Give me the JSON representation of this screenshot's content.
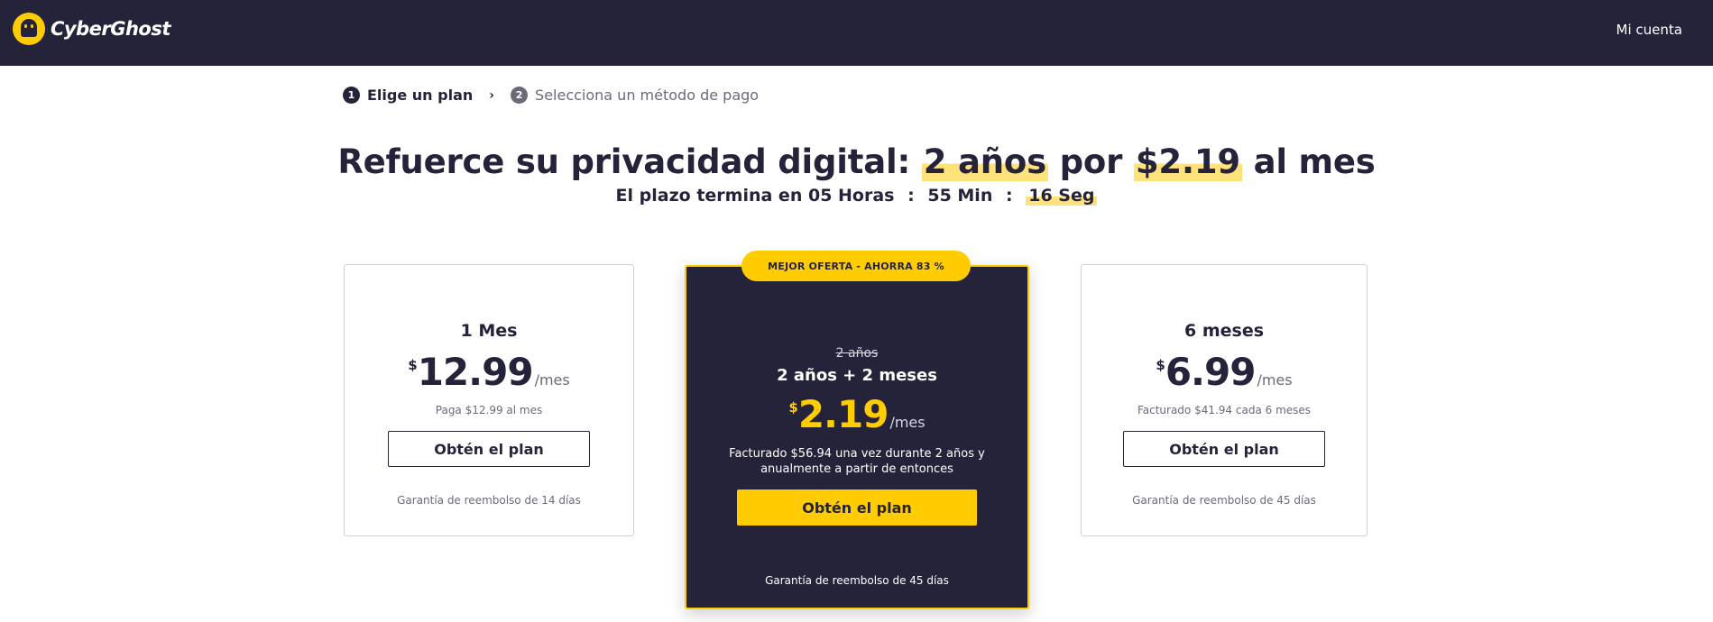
{
  "header": {
    "brand": "CyberGhost",
    "account_link": "Mi cuenta"
  },
  "steps": [
    {
      "number": "1",
      "label": "Elige un plan"
    },
    {
      "number": "2",
      "label": "Selecciona un método de pago"
    }
  ],
  "headline": {
    "prefix": "Refuerce su privacidad digital:",
    "term": "2 años",
    "mid": "por",
    "price": "$2.19",
    "suffix": "al mes"
  },
  "timer": {
    "label": "El plazo termina en",
    "hours": "05 Horas",
    "minutes": "55 Min",
    "seconds": "16 Seg"
  },
  "plans": {
    "monthly": {
      "title": "1 Mes",
      "currency": "$",
      "price": "12.99",
      "per": "/mes",
      "note": "Paga $12.99 al mes",
      "button": "Obtén el plan",
      "guarantee": "Garantía de reembolso de 14 días"
    },
    "best": {
      "badge": "MEJOR OFERTA - AHORRA 83 %",
      "strike": "2 años",
      "title": "2 años + 2 meses",
      "currency": "$",
      "price": "2.19",
      "per": "/mes",
      "note": "Facturado $56.94 una vez durante 2 años y anualmente a partir de entonces",
      "button": "Obtén el plan",
      "guarantee": "Garantía de reembolso de 45 días"
    },
    "six_months": {
      "title": "6 meses",
      "currency": "$",
      "price": "6.99",
      "per": "/mes",
      "note": "Facturado $41.94 cada 6 meses",
      "button": "Obtén el plan",
      "guarantee": "Garantía de reembolso de 45 días"
    }
  },
  "colors": {
    "navy": "#25233a",
    "accent": "#ffcc00",
    "highlight": "#ffe27a",
    "muted": "#6b6a7a"
  },
  "icons": {
    "logo": "ghost-logo-icon",
    "separator": "chevron-right-icon"
  }
}
